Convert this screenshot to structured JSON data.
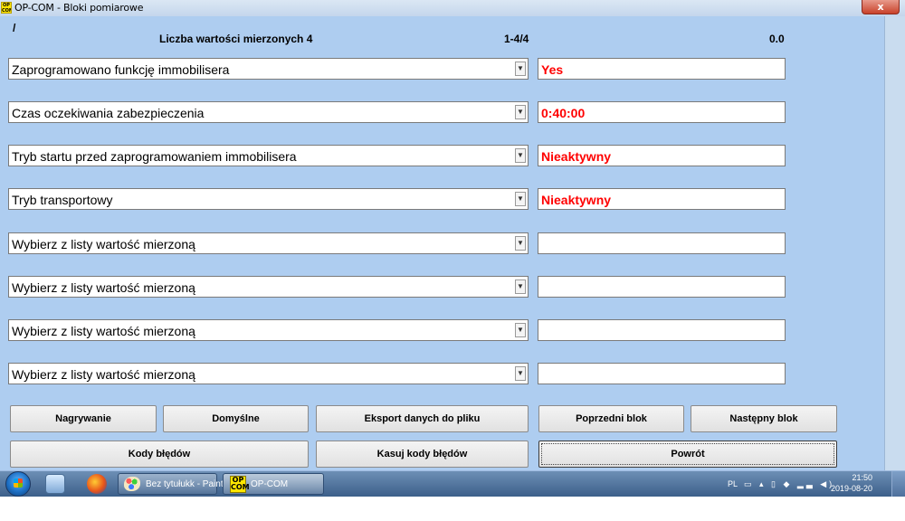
{
  "window": {
    "title": "OP-COM - Bloki pomiarowe",
    "icon_text": "OP COM",
    "close_glyph": "x"
  },
  "header": {
    "slash": "/",
    "count_label": "Liczba wartości mierzonych 4",
    "range": "1-4/4",
    "value": "0.0"
  },
  "rows": [
    {
      "label": "Zaprogramowano funkcję immobilisera",
      "value": "Yes"
    },
    {
      "label": "Czas oczekiwania zabezpieczenia",
      "value": "0:40:00"
    },
    {
      "label": "Tryb startu przed zaprogramowaniem immobilisera",
      "value": "Nieaktywny"
    },
    {
      "label": "Tryb transportowy",
      "value": "Nieaktywny"
    },
    {
      "label": "Wybierz z listy wartość mierzoną",
      "value": ""
    },
    {
      "label": "Wybierz z listy wartość mierzoną",
      "value": ""
    },
    {
      "label": "Wybierz z listy wartość mierzoną",
      "value": ""
    },
    {
      "label": "Wybierz z listy wartość mierzoną",
      "value": ""
    }
  ],
  "buttons": {
    "record": "Nagrywanie",
    "defaults": "Domyślne",
    "export": "Eksport danych do pliku",
    "prev_block": "Poprzedni blok",
    "next_block": "Następny blok",
    "error_codes": "Kody błędów",
    "clear_codes": "Kasuj kody błędów",
    "back": "Powrót"
  },
  "taskbar": {
    "paint_label": "Bez tytułukk - Paint",
    "opcom_label": "OP-COM",
    "opcom_icon_text": "OP COM",
    "language": "PL",
    "time": "21:50",
    "date": "2019-08-20"
  },
  "colors": {
    "background": "#aecdf0",
    "value_text": "#ff0000"
  }
}
